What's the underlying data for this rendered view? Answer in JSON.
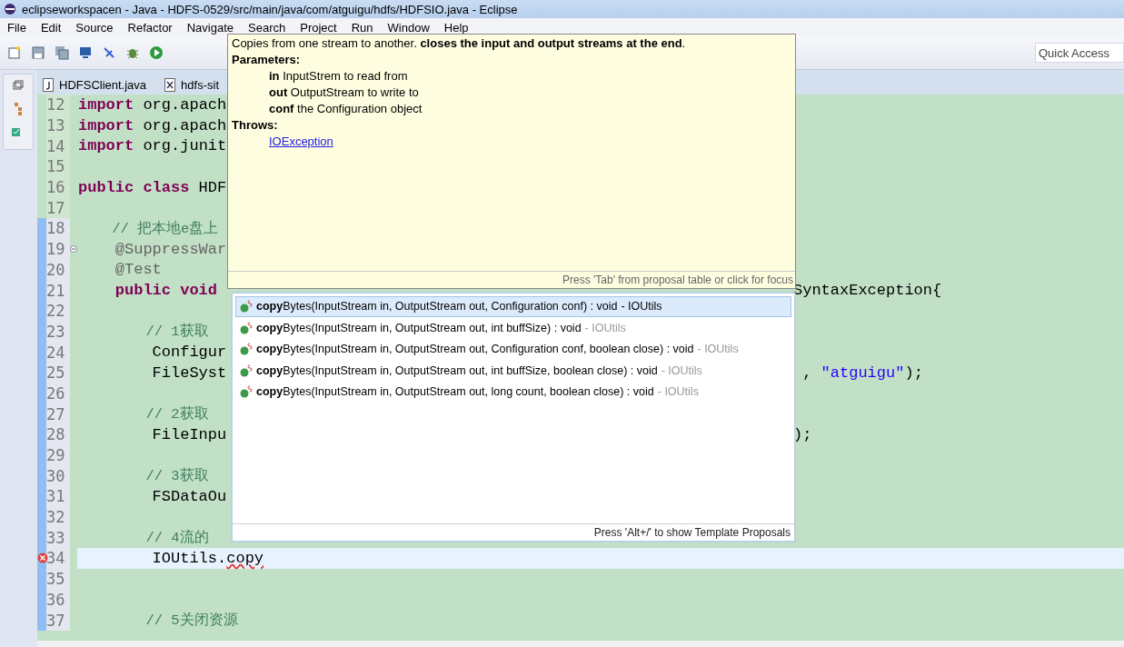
{
  "window": {
    "title": "eclipseworkspacen - Java - HDFS-0529/src/main/java/com/atguigu/hdfs/HDFSIO.java - Eclipse"
  },
  "menu": [
    "File",
    "Edit",
    "Source",
    "Refactor",
    "Navigate",
    "Search",
    "Project",
    "Run",
    "Window",
    "Help"
  ],
  "quick_access": {
    "placeholder": "Quick Access"
  },
  "tabs": [
    {
      "label": "HDFSClient.java",
      "kind": "java",
      "selected": false
    },
    {
      "label": "hdfs-sit",
      "kind": "xml",
      "selected": false
    }
  ],
  "editor": {
    "lines": [
      {
        "number": "12",
        "changed": false,
        "current": false,
        "error": false,
        "fold": false,
        "segments": [
          {
            "kind": "keyword",
            "text": "import"
          },
          {
            "kind": "plain",
            "text": " org.apach"
          }
        ]
      },
      {
        "number": "13",
        "changed": false,
        "current": false,
        "error": false,
        "fold": false,
        "segments": [
          {
            "kind": "keyword",
            "text": "import"
          },
          {
            "kind": "plain",
            "text": " org.apach"
          }
        ]
      },
      {
        "number": "14",
        "changed": false,
        "current": false,
        "error": false,
        "fold": false,
        "segments": [
          {
            "kind": "keyword",
            "text": "import"
          },
          {
            "kind": "plain",
            "text": " org.junit"
          }
        ]
      },
      {
        "number": "15",
        "changed": false,
        "current": false,
        "error": false,
        "fold": false
      },
      {
        "number": "16",
        "changed": false,
        "current": false,
        "error": false,
        "fold": false,
        "segments": [
          {
            "kind": "keyword",
            "text": "public class"
          },
          {
            "kind": "plain",
            "text": " HDF"
          }
        ]
      },
      {
        "number": "17",
        "changed": false,
        "current": false,
        "error": false,
        "fold": false
      },
      {
        "number": "18",
        "changed": true,
        "current": false,
        "error": false,
        "fold": false,
        "segments": [
          {
            "kind": "comment",
            "text": "    // 把本地e盘上"
          }
        ]
      },
      {
        "number": "19",
        "changed": true,
        "current": false,
        "error": false,
        "fold": true,
        "segments": [
          {
            "kind": "annotation",
            "text": "    @SuppressWar"
          }
        ]
      },
      {
        "number": "20",
        "changed": true,
        "current": false,
        "error": false,
        "fold": false,
        "segments": [
          {
            "kind": "annotation",
            "text": "    @Test"
          }
        ]
      },
      {
        "number": "21",
        "changed": true,
        "current": false,
        "error": false,
        "fold": false,
        "segments": [
          {
            "kind": "keyword",
            "text": "    public void"
          }
        ],
        "right": [
          {
            "kind": "plain",
            "text": "SyntaxException{"
          }
        ]
      },
      {
        "number": "22",
        "changed": true,
        "current": false,
        "error": false,
        "fold": false
      },
      {
        "number": "23",
        "changed": true,
        "current": false,
        "error": false,
        "fold": false,
        "segments": [
          {
            "kind": "comment",
            "text": "        // 1获取"
          }
        ]
      },
      {
        "number": "24",
        "changed": true,
        "current": false,
        "error": false,
        "fold": false,
        "segments": [
          {
            "kind": "plain",
            "text": "        Configur"
          }
        ]
      },
      {
        "number": "25",
        "changed": true,
        "current": false,
        "error": false,
        "fold": false,
        "segments": [
          {
            "kind": "plain",
            "text": "        FileSyst"
          }
        ],
        "right": [
          {
            "kind": "plain",
            "text": " , "
          },
          {
            "kind": "string",
            "text": "\"atguigu\""
          },
          {
            "kind": "plain",
            "text": ");"
          }
        ]
      },
      {
        "number": "26",
        "changed": true,
        "current": false,
        "error": false,
        "fold": false
      },
      {
        "number": "27",
        "changed": true,
        "current": false,
        "error": false,
        "fold": false,
        "segments": [
          {
            "kind": "comment",
            "text": "        // 2获取"
          }
        ]
      },
      {
        "number": "28",
        "changed": true,
        "current": false,
        "error": false,
        "fold": false,
        "segments": [
          {
            "kind": "plain",
            "text": "        FileInpu"
          }
        ],
        "right": [
          {
            "kind": "plain",
            "text": ");"
          }
        ]
      },
      {
        "number": "29",
        "changed": true,
        "current": false,
        "error": false,
        "fold": false
      },
      {
        "number": "30",
        "changed": true,
        "current": false,
        "error": false,
        "fold": false,
        "segments": [
          {
            "kind": "comment",
            "text": "        // 3获取"
          }
        ]
      },
      {
        "number": "31",
        "changed": true,
        "current": false,
        "error": false,
        "fold": false,
        "segments": [
          {
            "kind": "plain",
            "text": "        FSDataOu"
          }
        ]
      },
      {
        "number": "32",
        "changed": true,
        "current": false,
        "error": false,
        "fold": false
      },
      {
        "number": "33",
        "changed": true,
        "current": false,
        "error": false,
        "fold": false,
        "segments": [
          {
            "kind": "comment",
            "text": "        // 4流的"
          }
        ]
      },
      {
        "number": "34",
        "changed": true,
        "current": true,
        "error": true,
        "fold": false,
        "segments": [
          {
            "kind": "plain",
            "text": "        IOUtils."
          },
          {
            "kind": "squiggle",
            "text": "copy"
          }
        ]
      },
      {
        "number": "35",
        "changed": true,
        "current": false,
        "error": false,
        "fold": false
      },
      {
        "number": "36",
        "changed": true,
        "current": false,
        "error": false,
        "fold": false
      },
      {
        "number": "37",
        "changed": true,
        "current": false,
        "error": false,
        "fold": false,
        "segments": [
          {
            "kind": "comment",
            "text": "        // 5关闭资源"
          }
        ]
      }
    ]
  },
  "javadoc": {
    "description": "Copies from one stream to another. **closes the input and output streams at the end**.",
    "parameters_heading": "Parameters:",
    "parameters": [
      {
        "name": "in",
        "text": "InputStrem to read from"
      },
      {
        "name": "out",
        "text": "OutputStream to write to"
      },
      {
        "name": "conf",
        "text": "the Configuration object"
      }
    ],
    "throws_heading": "Throws:",
    "throws": [
      "IOException"
    ],
    "footer": "Press 'Tab' from proposal table or click for focus"
  },
  "proposals": {
    "items": [
      {
        "label": "**copy**Bytes(InputStream in, OutputStream out, Configuration conf) : void",
        "owner": "- IOUtils",
        "selected": true
      },
      {
        "label": "**copy**Bytes(InputStream in, OutputStream out, int buffSize) : void",
        "owner": "- IOUtils",
        "selected": false
      },
      {
        "label": "**copy**Bytes(InputStream in, OutputStream out, Configuration conf, boolean close) : void",
        "owner": "- IOUtils",
        "selected": false
      },
      {
        "label": "**copy**Bytes(InputStream in, OutputStream out, int buffSize, boolean close) : void",
        "owner": "- IOUtils",
        "selected": false
      },
      {
        "label": "**copy**Bytes(InputStream in, OutputStream out, long count, boolean close) : void",
        "owner": "- IOUtils",
        "selected": false
      }
    ],
    "footer": "Press 'Alt+/' to show Template Proposals"
  }
}
